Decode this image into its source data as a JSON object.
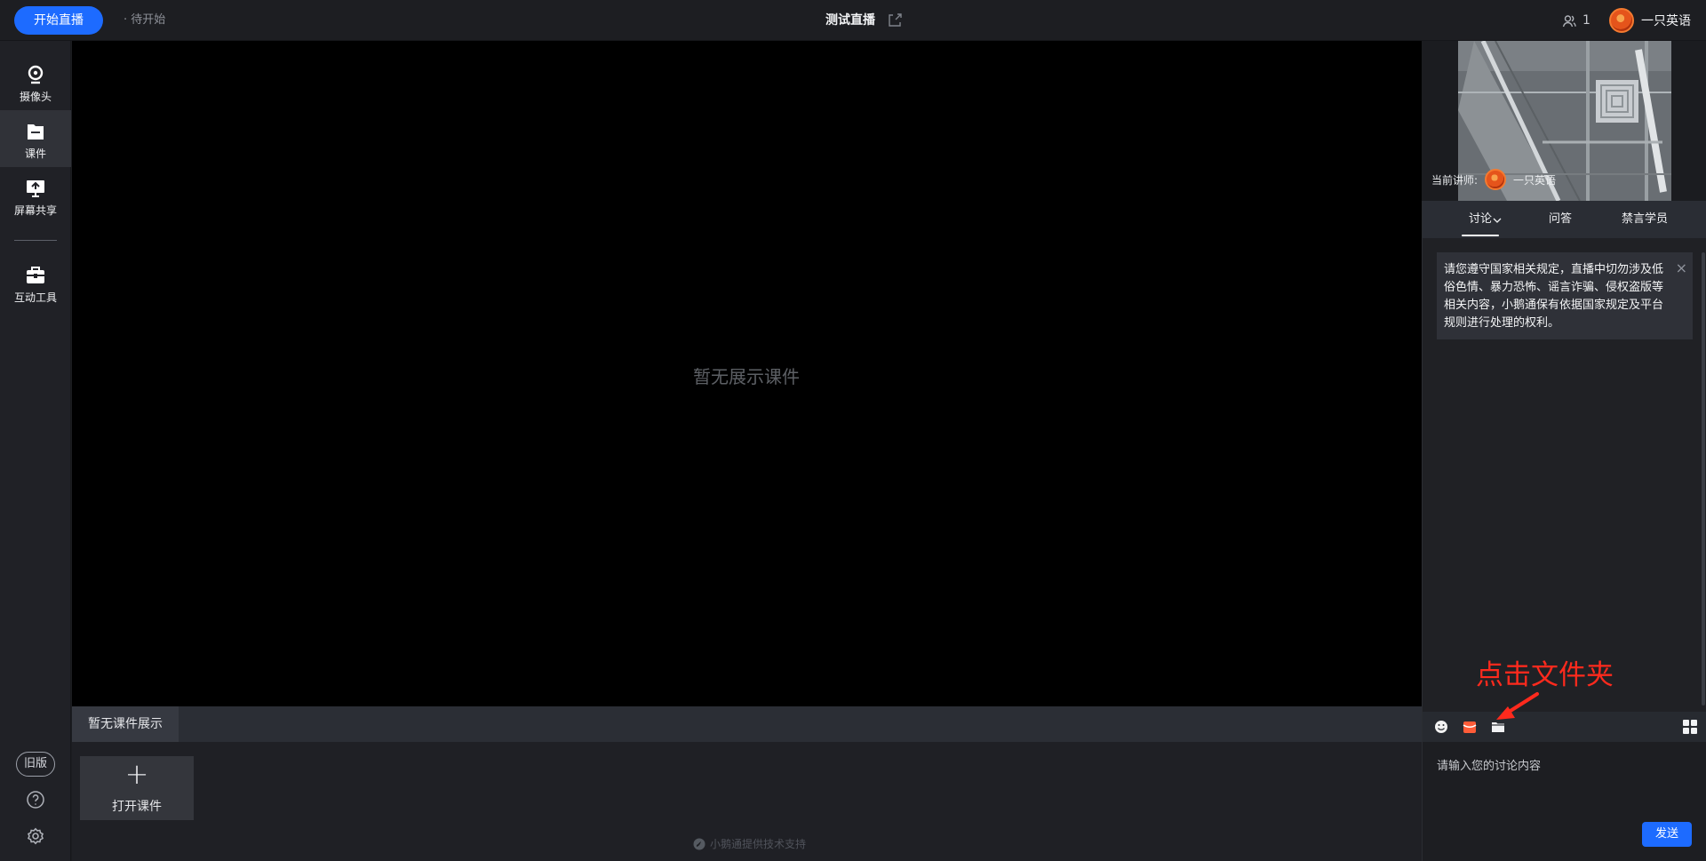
{
  "header": {
    "start_button": "开始直播",
    "status": "· 待开始",
    "room_title": "测试直播",
    "viewer_count": "1",
    "username": "一只英语"
  },
  "sidebar": {
    "items": [
      {
        "label": "摄像头",
        "icon": "camera-icon"
      },
      {
        "label": "课件",
        "icon": "folder-icon"
      },
      {
        "label": "屏幕共享",
        "icon": "screen-share-icon"
      },
      {
        "label": "互动工具",
        "icon": "toolbox-icon"
      }
    ],
    "old_version": "旧版"
  },
  "stage": {
    "empty_text": "暂无展示课件",
    "bottom_tab": "暂无课件展示",
    "open_course": "打开课件",
    "footer": "小鹅通提供技术支持"
  },
  "right_panel": {
    "teacher_label": "当前讲师:",
    "teacher_name": "一只英语",
    "tabs": [
      {
        "label": "讨论"
      },
      {
        "label": "问答"
      },
      {
        "label": "禁言学员"
      }
    ],
    "notice": "请您遵守国家相关规定，直播中切勿涉及低俗色情、暴力恐怖、谣言诈骗、侵权盗版等相关内容，小鹅通保有依据国家规定及平台规则进行处理的权利。",
    "annotation": "点击文件夹",
    "input_placeholder": "请输入您的讨论内容",
    "send_button": "发送"
  },
  "colors": {
    "accent": "#1d6bff",
    "annotation": "#ff2a1d",
    "background": "#000000"
  }
}
